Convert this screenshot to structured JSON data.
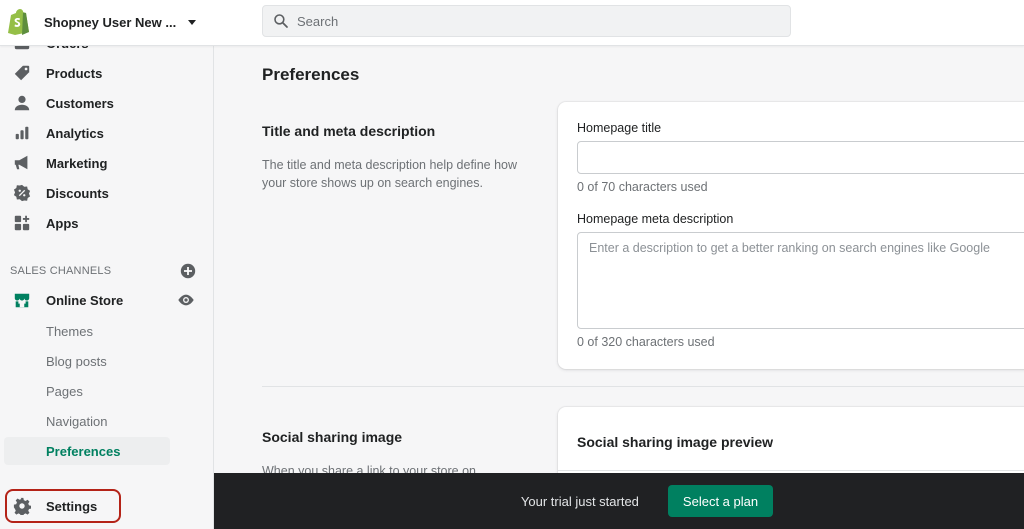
{
  "header": {
    "store_name": "Shopney User New ...",
    "search_placeholder": "Search"
  },
  "sidebar": {
    "items": [
      {
        "label": "Orders",
        "icon": "inbox-icon"
      },
      {
        "label": "Products",
        "icon": "tag-icon"
      },
      {
        "label": "Customers",
        "icon": "person-icon"
      },
      {
        "label": "Analytics",
        "icon": "bar-chart-icon"
      },
      {
        "label": "Marketing",
        "icon": "megaphone-icon"
      },
      {
        "label": "Discounts",
        "icon": "discount-badge-icon"
      },
      {
        "label": "Apps",
        "icon": "apps-grid-icon"
      }
    ],
    "sales_channels_label": "SALES CHANNELS",
    "online_store": {
      "label": "Online Store",
      "sub_items": [
        {
          "label": "Themes"
        },
        {
          "label": "Blog posts"
        },
        {
          "label": "Pages"
        },
        {
          "label": "Navigation"
        },
        {
          "label": "Preferences",
          "active": true
        }
      ]
    },
    "settings_label": "Settings"
  },
  "main": {
    "page_title": "Preferences",
    "title_meta": {
      "heading": "Title and meta description",
      "description": "The title and meta description help define how your store shows up on search engines.",
      "homepage_title_label": "Homepage title",
      "homepage_title_value": "",
      "homepage_title_help": "0 of 70 characters used",
      "meta_label": "Homepage meta description",
      "meta_placeholder": "Enter a description to get a better ranking on search engines like Google",
      "meta_value": "",
      "meta_help": "0 of 320 characters used"
    },
    "social": {
      "heading": "Social sharing image",
      "description": "When you share a link to your store on",
      "preview_title": "Social sharing image preview"
    }
  },
  "trial_bar": {
    "text": "Your trial just started",
    "button_label": "Select a plan"
  },
  "colors": {
    "accent": "#008060",
    "highlight_border": "#b42318",
    "trial_bar_bg": "#202123"
  }
}
